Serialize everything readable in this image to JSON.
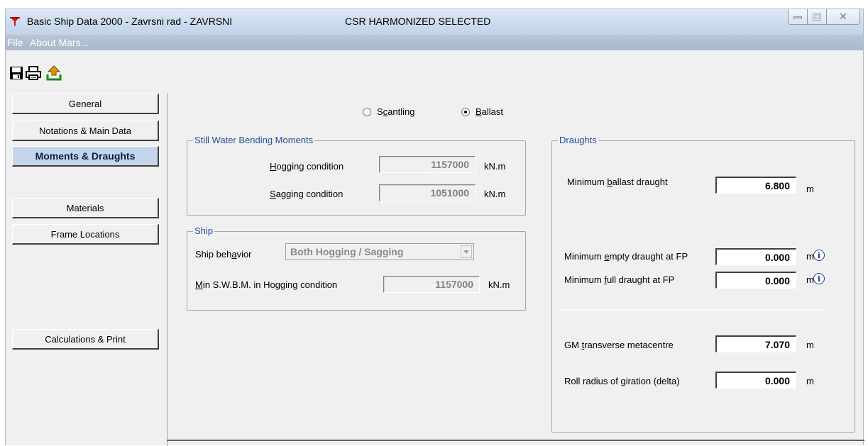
{
  "window": {
    "title": "Basic Ship Data 2000 - Zavrsni rad - ZAVRSNI",
    "subtitle": "CSR HARMONIZED SELECTED"
  },
  "menu": {
    "file": "File",
    "about": "About Mars..."
  },
  "nav": {
    "general": "General",
    "notations": "Notations & Main Data",
    "moments": "Moments & Draughts",
    "materials": "Materials",
    "frames": "Frame Locations",
    "calc": "Calculations & Print"
  },
  "mode": {
    "scantling": "Scantling",
    "ballast": "Ballast",
    "selected": "Ballast"
  },
  "swbm": {
    "legend": "Still Water Bending Moments",
    "hogging_label": "Hogging condition",
    "hogging_value": "1157000",
    "sagging_label": "Sagging  condition",
    "sagging_value": "1051000",
    "unit": "kN.m"
  },
  "ship": {
    "legend": "Ship",
    "behavior_label": "Ship behavior",
    "behavior_value": "Both Hogging / Sagging",
    "min_label": "Min S.W.B.M. in Hogging condition",
    "min_value": "1157000",
    "unit": "kN.m"
  },
  "draughts": {
    "legend": "Draughts",
    "min_ballast_label": "Minimum ballast draught",
    "min_ballast_value": "6.800",
    "min_empty_label": "Minimum empty draught at FP",
    "min_empty_value": "0.000",
    "min_full_label": "Minimum full draught at FP",
    "min_full_value": "0.000",
    "gm_label": "GM transverse metacentre",
    "gm_value": "7.070",
    "roll_label": "Roll radius of giration (delta)",
    "roll_value": "0.000",
    "unit": "m"
  },
  "icons": {
    "app": "ship-filter-icon",
    "save": "save-icon",
    "print": "print-icon",
    "export": "export-icon",
    "info": "info-icon"
  },
  "colors": {
    "title_bg": "#cddcee",
    "active_nav": "#c5d6ea",
    "legend_text": "#1f4f9a"
  }
}
